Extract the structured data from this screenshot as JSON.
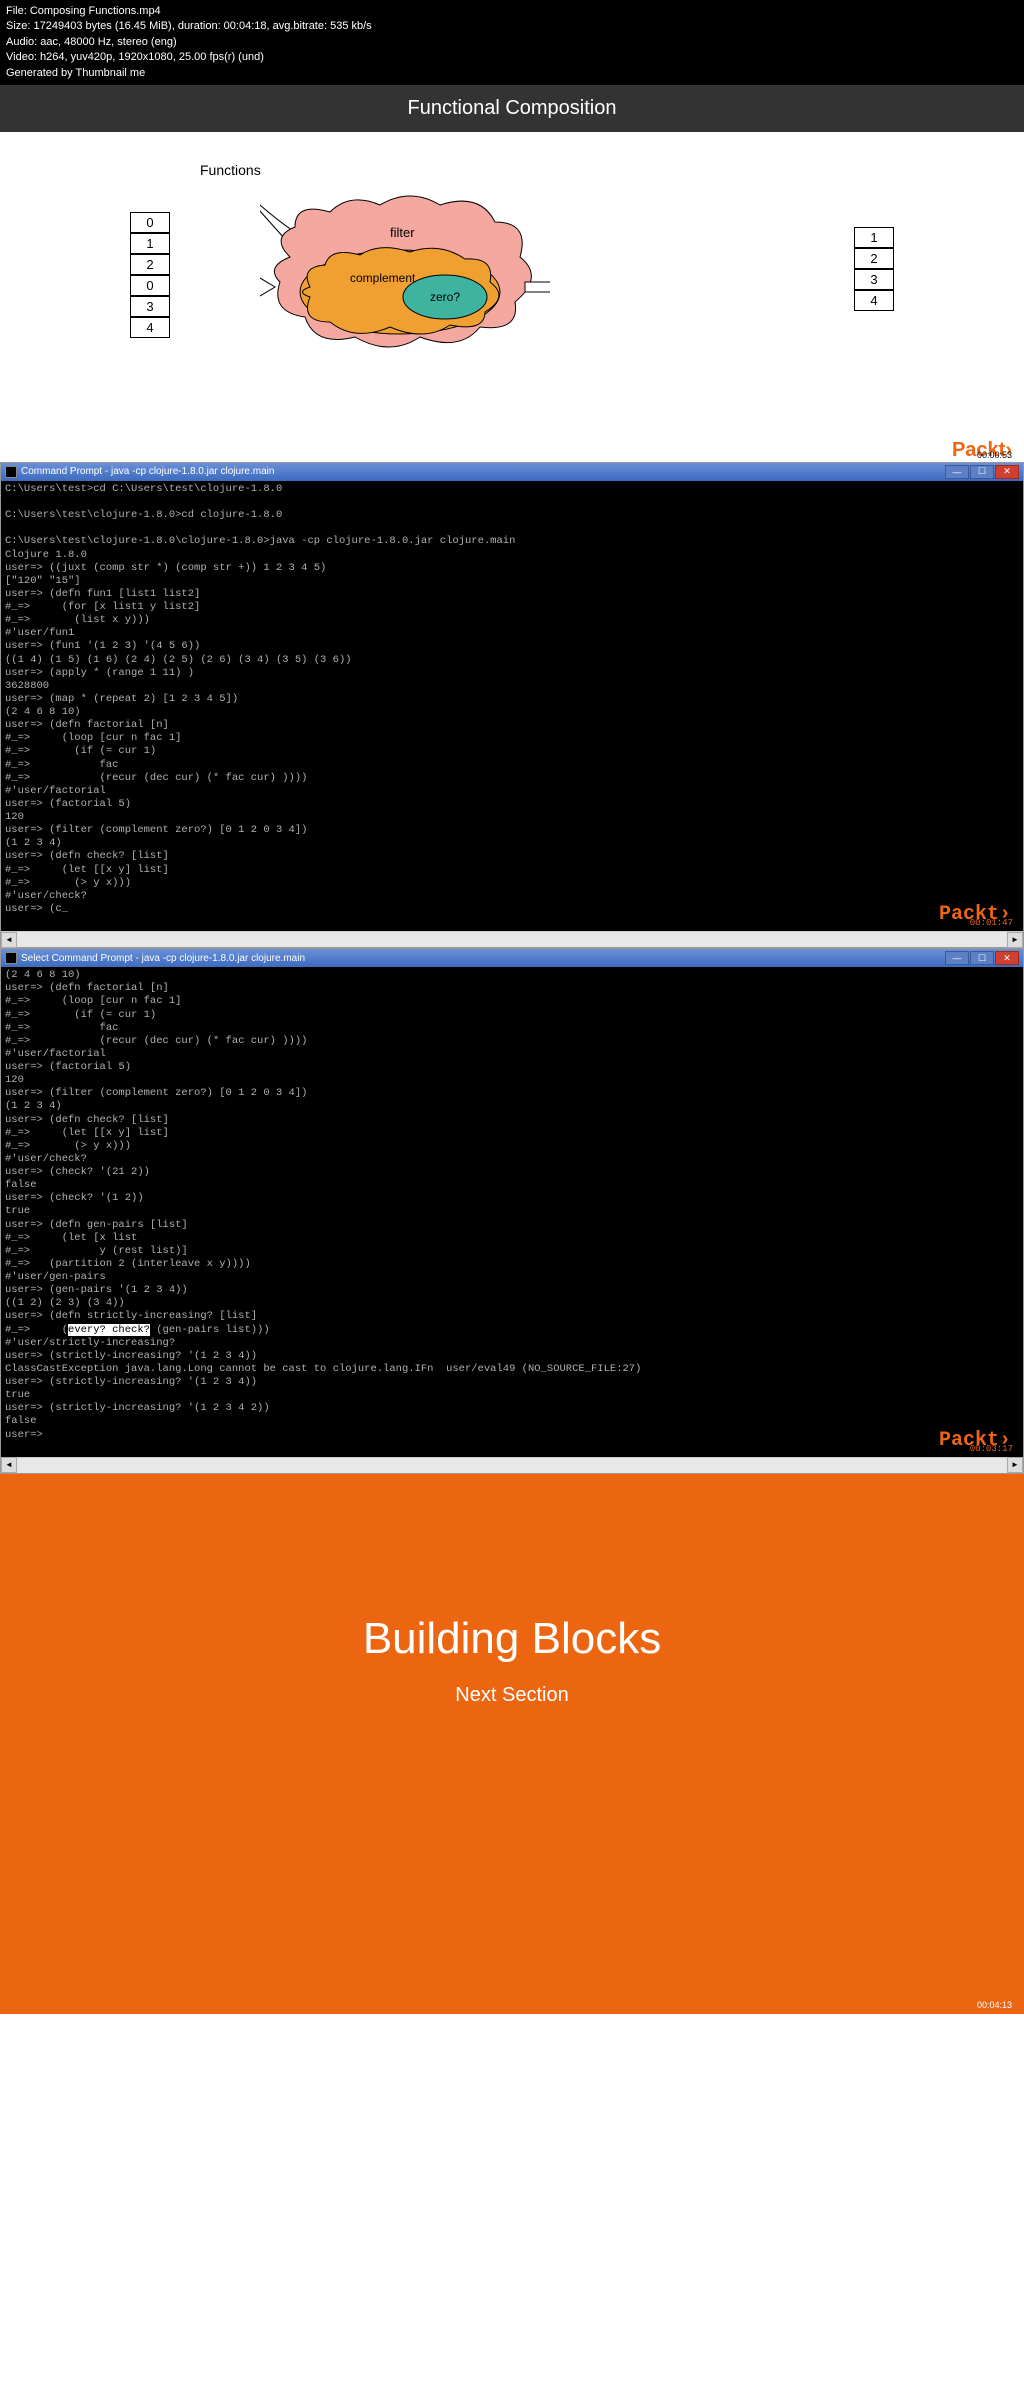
{
  "metadata": {
    "file": "File: Composing Functions.mp4",
    "size": "Size: 17249403 bytes (16.45 MiB), duration: 00:04:18, avg.bitrate: 535 kb/s",
    "audio": "Audio: aac, 48000 Hz, stereo (eng)",
    "video": "Video: h264, yuv420p, 1920x1080, 25.00 fps(r) (und)",
    "generated": "Generated by Thumbnail me"
  },
  "title": "Functional Composition",
  "diagram": {
    "functions_label": "Functions",
    "input": [
      "0",
      "1",
      "2",
      "0",
      "3",
      "4"
    ],
    "output": [
      "1",
      "2",
      "3",
      "4"
    ],
    "filter": "filter",
    "complement": "complement",
    "zero": "zero?",
    "timestamp": "00:00:53"
  },
  "terminal1": {
    "title": "Command Prompt - java  -cp clojure-1.8.0.jar clojure.main",
    "content": "C:\\Users\\test>cd C:\\Users\\test\\clojure-1.8.0\n\nC:\\Users\\test\\clojure-1.8.0>cd clojure-1.8.0\n\nC:\\Users\\test\\clojure-1.8.0\\clojure-1.8.0>java -cp clojure-1.8.0.jar clojure.main\nClojure 1.8.0\nuser=> ((juxt (comp str *) (comp str +)) 1 2 3 4 5)\n[\"120\" \"15\"]\nuser=> (defn fun1 [list1 list2]\n#_=>     (for [x list1 y list2]\n#_=>       (list x y)))\n#'user/fun1\nuser=> (fun1 '(1 2 3) '(4 5 6))\n((1 4) (1 5) (1 6) (2 4) (2 5) (2 6) (3 4) (3 5) (3 6))\nuser=> (apply * (range 1 11) )\n3628800\nuser=> (map * (repeat 2) [1 2 3 4 5])\n(2 4 6 8 10)\nuser=> (defn factorial [n]\n#_=>     (loop [cur n fac 1]\n#_=>       (if (= cur 1)\n#_=>           fac\n#_=>           (recur (dec cur) (* fac cur) ))))\n#'user/factorial\nuser=> (factorial 5)\n120\nuser=> (filter (complement zero?) [0 1 2 0 3 4])\n(1 2 3 4)\nuser=> (defn check? [list]\n#_=>     (let [[x y] list]\n#_=>       (> y x)))\n#'user/check?\nuser=> (c_",
    "timestamp": "00:01:47"
  },
  "terminal2": {
    "title": "Select Command Prompt - java  -cp clojure-1.8.0.jar clojure.main",
    "content_a": "(2 4 6 8 10)\nuser=> (defn factorial [n]\n#_=>     (loop [cur n fac 1]\n#_=>       (if (= cur 1)\n#_=>           fac\n#_=>           (recur (dec cur) (* fac cur) ))))\n#'user/factorial\nuser=> (factorial 5)\n120\nuser=> (filter (complement zero?) [0 1 2 0 3 4])\n(1 2 3 4)\nuser=> (defn check? [list]\n#_=>     (let [[x y] list]\n#_=>       (> y x)))\n#'user/check?\nuser=> (check? '(21 2))\nfalse\nuser=> (check? '(1 2))\ntrue\nuser=> (defn gen-pairs [list]\n#_=>     (let [x list\n#_=>           y (rest list)]\n#_=>   (partition 2 (interleave x y))))\n#'user/gen-pairs\nuser=> (gen-pairs '(1 2 3 4))\n((1 2) (2 3) (3 4))\nuser=> (defn strictly-increasing? [list]\n#_=>     (",
    "highlight": "every? check?",
    "content_b": " (gen-pairs list)))\n#'user/strictly-increasing?\nuser=> (strictly-increasing? '(1 2 3 4))\nClassCastException java.lang.Long cannot be cast to clojure.lang.IFn  user/eval49 (NO_SOURCE_FILE:27)\nuser=> (strictly-increasing? '(1 2 3 4))\ntrue\nuser=> (strictly-increasing? '(1 2 3 4 2))\nfalse\nuser=>",
    "timestamp": "00:03:17"
  },
  "orange": {
    "title": "Building Blocks",
    "subtitle": "Next Section",
    "timestamp": "00:04:13"
  },
  "packt": "Packt"
}
